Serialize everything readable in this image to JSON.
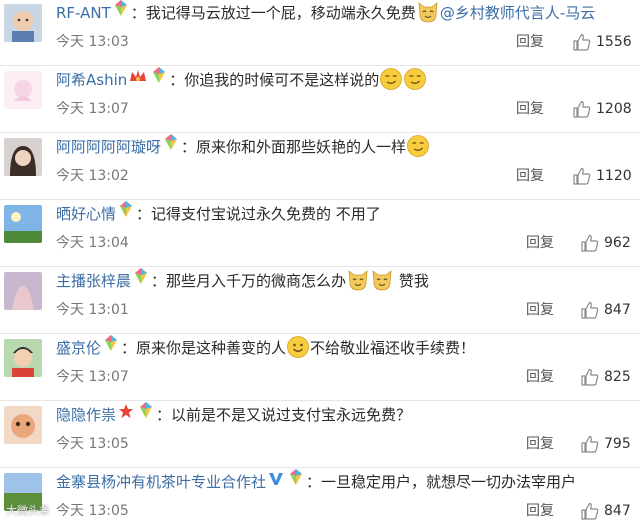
{
  "comments": [
    {
      "user": "RF-ANT",
      "badges": [
        "gem"
      ],
      "content_parts": [
        {
          "t": "我记得马云放过一个屁，移动端永久免费"
        },
        {
          "e": "cat"
        },
        {
          "t": "@乡村教师代言人-马云",
          "mention": true
        }
      ],
      "time": "今天 13:03",
      "reply": "回复",
      "likes": "1556",
      "avatar": "baby"
    },
    {
      "user": "阿希Ashin",
      "badges": [
        "crown",
        "gem"
      ],
      "content_parts": [
        {
          "t": "你追我的时候可不是这样说的"
        },
        {
          "e": "smirk"
        },
        {
          "e": "smirk"
        }
      ],
      "time": "今天 13:07",
      "reply": "回复",
      "likes": "1208",
      "avatar": "pink"
    },
    {
      "user": "阿阿阿阿阿璇呀",
      "badges": [
        "gem"
      ],
      "content_parts": [
        {
          "t": "原来你和外面那些妖艳的人一样"
        },
        {
          "e": "smirk"
        }
      ],
      "time": "今天 13:02",
      "reply": "回复",
      "likes": "1120",
      "avatar": "girl"
    },
    {
      "user": "晒好心情",
      "badges": [
        "gem"
      ],
      "content_parts": [
        {
          "t": "记得支付宝说过永久免费的  不用了"
        }
      ],
      "time": "今天 13:04",
      "reply": "回复",
      "likes": "962",
      "avatar": "sky"
    },
    {
      "user": "主播张梓晨",
      "badges": [
        "gem"
      ],
      "content_parts": [
        {
          "t": "那些月入千万的微商怎么办"
        },
        {
          "e": "cat"
        },
        {
          "e": "cat"
        },
        {
          "t": " 赞我"
        }
      ],
      "time": "今天 13:01",
      "reply": "回复",
      "likes": "847",
      "avatar": "purple"
    },
    {
      "user": "盛京伦",
      "badges": [
        "gem"
      ],
      "content_parts": [
        {
          "t": "原来你是这种善变的人"
        },
        {
          "e": "smile"
        },
        {
          "t": "不给敬业福还收手续费！"
        }
      ],
      "time": "今天 13:07",
      "reply": "回复",
      "likes": "825",
      "avatar": "boy"
    },
    {
      "user": "隐隐作祟",
      "badges": [
        "star",
        "gem"
      ],
      "content_parts": [
        {
          "t": "以前是不是又说过支付宝永远免费？"
        }
      ],
      "time": "今天 13:05",
      "reply": "回复",
      "likes": "795",
      "avatar": "cat"
    },
    {
      "user": "金寨县杨冲有机茶叶专业合作社",
      "badges": [
        "v",
        "gem"
      ],
      "content_parts": [
        {
          "t": "一旦稳定用户，就想尽一切办法宰用户"
        }
      ],
      "time": "今天 13:05",
      "reply": "回复",
      "likes": "847",
      "avatar": "field"
    }
  ],
  "separator": "：",
  "watermark": "大微头条",
  "colors": {
    "username": "#3b6ea5",
    "text": "#2a2a2a",
    "meta": "#777777",
    "divider": "#e6e6e6"
  }
}
